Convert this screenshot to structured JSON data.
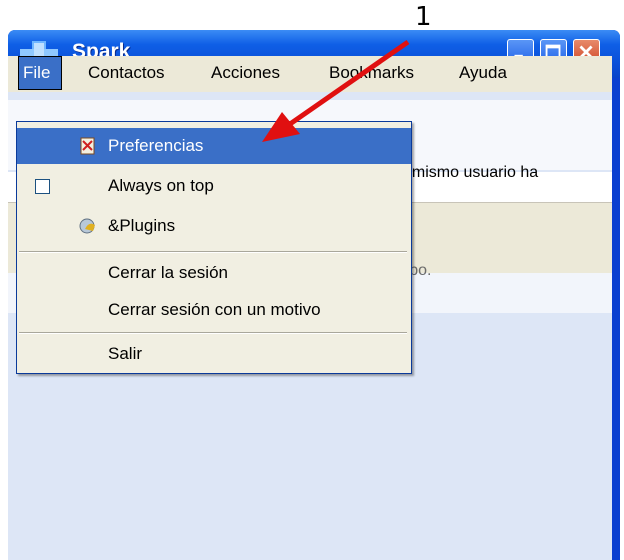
{
  "annotation": {
    "number": "1"
  },
  "window": {
    "title": "Spark",
    "controls": {
      "minimize_icon": "minimize-icon",
      "maximize_icon": "maximize-icon",
      "close_icon": "close-icon"
    }
  },
  "menubar": {
    "items": [
      {
        "label": "File",
        "active": true
      },
      {
        "label": "Contactos"
      },
      {
        "label": "Acciones"
      },
      {
        "label": "Bookmarks"
      },
      {
        "label": "Ayuda"
      }
    ]
  },
  "file_menu": {
    "items": [
      {
        "label": "Preferencias",
        "icon": "preferences-icon",
        "highlighted": true
      },
      {
        "label": "Always on top",
        "checkbox": false
      },
      {
        "label": "&Plugins",
        "icon": "plugins-icon"
      },
      {
        "label": "Cerrar la sesión"
      },
      {
        "label": "Cerrar sesión con un motivo"
      },
      {
        "label": "Salir"
      }
    ]
  },
  "background": {
    "text1": "el mismo usuario ha",
    "text2": "rupo."
  },
  "colors": {
    "title_bar": "#0a4fd8",
    "menu_highlight": "#3a6fc7",
    "annotation_arrow": "#e01010",
    "close_button": "#cf4424"
  }
}
